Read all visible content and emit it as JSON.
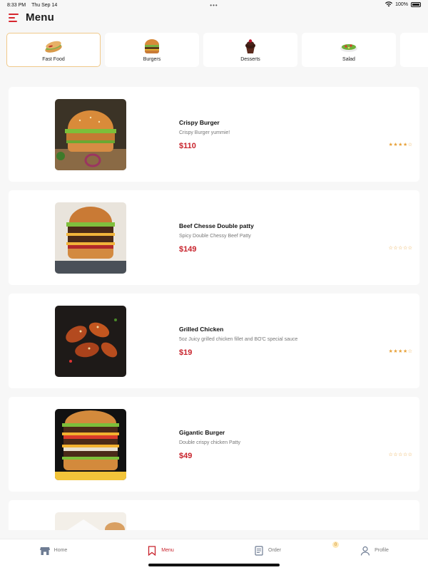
{
  "status": {
    "time": "8:33 PM",
    "date": "Thu Sep 14",
    "battery": "100%",
    "dots": "•••"
  },
  "header": {
    "title": "Menu"
  },
  "categories": [
    {
      "label": "Fast Food",
      "icon": "sandwich-icon",
      "active": true
    },
    {
      "label": "Burgers",
      "icon": "burger-icon",
      "active": false
    },
    {
      "label": "Desserts",
      "icon": "cupcake-icon",
      "active": false
    },
    {
      "label": "Salad",
      "icon": "salad-icon",
      "active": false
    }
  ],
  "items": [
    {
      "name": "Crispy Burger",
      "description": "Crispy Burger yummie!",
      "price": "$110",
      "rating": 4,
      "image": "burger-photo"
    },
    {
      "name": "Beef Chesse Double patty",
      "description": "Spicy Double Chessy Beef Patty",
      "price": "$149",
      "rating": 0,
      "image": "double-burger-photo"
    },
    {
      "name": "Grilled Chicken",
      "description": "5oz Juicy grilled chicken fillet and BO'C special sauce",
      "price": "$19",
      "rating": 4,
      "image": "chicken-wings-photo"
    },
    {
      "name": "Gigantic Burger",
      "description": "Double crispy chicken Patty",
      "price": "$49",
      "rating": 0,
      "image": "tall-burger-photo"
    }
  ],
  "nav": {
    "home": "Home",
    "menu": "Menu",
    "order": "Order",
    "profile": "Profile",
    "order_badge": "0"
  },
  "colors": {
    "accent": "#c8232c",
    "star": "#e8a23a",
    "active_border": "#f0c98a"
  }
}
